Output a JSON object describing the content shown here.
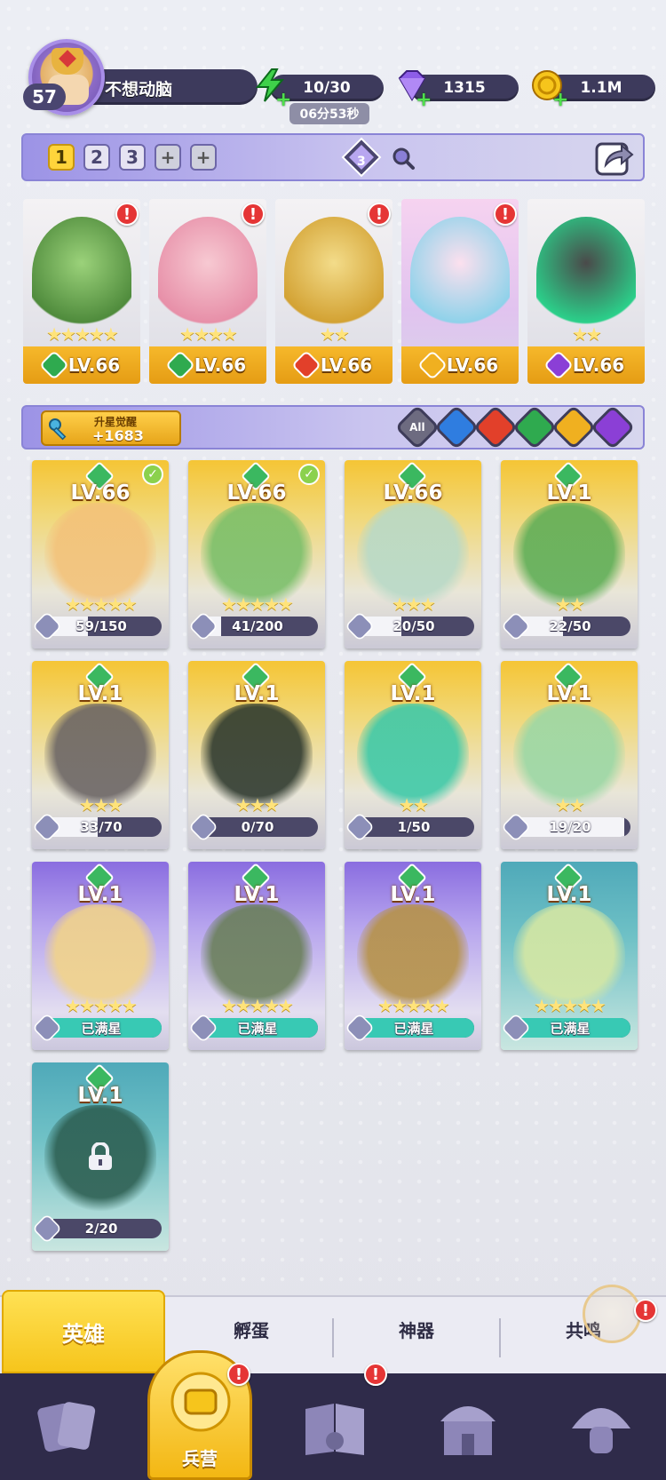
{
  "player": {
    "level": "57",
    "name": "不想动脑"
  },
  "resources": {
    "energy": {
      "value": "10/30",
      "timer": "06分53秒",
      "icon": "lightning-icon"
    },
    "gems": {
      "value": "1315",
      "icon": "gem-icon"
    },
    "gold": {
      "value": "1.1M",
      "icon": "coin-icon"
    }
  },
  "team_bar": {
    "tabs": [
      "1",
      "2",
      "3",
      "+",
      "+"
    ],
    "active_tab": "1",
    "crystal_count": "3"
  },
  "team": [
    {
      "level": "LV.66",
      "stars": 5,
      "element": "nature",
      "alert": "!"
    },
    {
      "level": "LV.66",
      "stars": 4,
      "element": "nature",
      "alert": "!"
    },
    {
      "level": "LV.66",
      "stars": 2,
      "element": "fire",
      "alert": "!"
    },
    {
      "level": "LV.66",
      "stars": 0,
      "element": "light",
      "alert": "!"
    },
    {
      "level": "LV.66",
      "stars": 2,
      "element": "dark",
      "alert": ""
    }
  ],
  "awaken": {
    "label": "升星觉醒",
    "count": "+1683"
  },
  "filters": [
    {
      "label": "All",
      "color": "#6d6b80",
      "icon": "all-filter-icon"
    },
    {
      "label": "",
      "color": "#2f7de0",
      "icon": "water-filter-icon"
    },
    {
      "label": "",
      "color": "#e2402a",
      "icon": "fire-filter-icon"
    },
    {
      "label": "",
      "color": "#2faa4f",
      "icon": "nature-filter-icon"
    },
    {
      "label": "",
      "color": "#f0b020",
      "icon": "light-filter-icon"
    },
    {
      "label": "",
      "color": "#8b3fd6",
      "icon": "dark-filter-icon"
    }
  ],
  "heroes": [
    {
      "level": "LV.66",
      "progress": "59/150",
      "frac": 0.39,
      "stars": 5,
      "rarity": "gold",
      "checked": true,
      "art": "#f3c27a"
    },
    {
      "level": "LV.66",
      "progress": "41/200",
      "frac": 0.2,
      "stars": 5,
      "rarity": "gold",
      "checked": true,
      "art": "#7bbf6a"
    },
    {
      "level": "LV.66",
      "progress": "20/50",
      "frac": 0.4,
      "stars": 3,
      "rarity": "gold",
      "checked": false,
      "art": "#b8d9c7"
    },
    {
      "level": "LV.1",
      "progress": "22/50",
      "frac": 0.44,
      "stars": 2,
      "rarity": "gold",
      "checked": false,
      "art": "#5fae57"
    },
    {
      "level": "LV.1",
      "progress": "33/70",
      "frac": 0.47,
      "stars": 3,
      "rarity": "gold",
      "checked": false,
      "art": "#6b6565"
    },
    {
      "level": "LV.1",
      "progress": "0/70",
      "frac": 0.0,
      "stars": 3,
      "rarity": "gold",
      "checked": false,
      "art": "#2f3a2f"
    },
    {
      "level": "LV.1",
      "progress": "1/50",
      "frac": 0.02,
      "stars": 2,
      "rarity": "gold",
      "checked": false,
      "art": "#3fc9a8"
    },
    {
      "level": "LV.1",
      "progress": "19/20",
      "frac": 0.95,
      "stars": 2,
      "rarity": "gold",
      "checked": false,
      "art": "#9bd7a5"
    },
    {
      "level": "LV.1",
      "progress": "已满星",
      "frac": 1.0,
      "stars": 5,
      "rarity": "purple",
      "checked": false,
      "art": "#f1d38a"
    },
    {
      "level": "LV.1",
      "progress": "已满星",
      "frac": 1.0,
      "stars": 5,
      "rarity": "purple",
      "checked": false,
      "art": "#6a7f5a"
    },
    {
      "level": "LV.1",
      "progress": "已满星",
      "frac": 1.0,
      "stars": 5,
      "rarity": "purple",
      "checked": false,
      "art": "#b69248"
    },
    {
      "level": "LV.1",
      "progress": "已满星",
      "frac": 1.0,
      "stars": 5,
      "rarity": "teal",
      "checked": false,
      "art": "#d5e7a3"
    },
    {
      "level": "LV.1",
      "progress": "2/20",
      "frac": 0.1,
      "stars": 0,
      "rarity": "teal",
      "checked": false,
      "art": "#2d5f52",
      "locked": true
    }
  ],
  "section_tabs": [
    "英雄",
    "孵蛋",
    "神器",
    "共鸣"
  ],
  "bottom_nav": {
    "items": [
      "cards-icon",
      "barracks-icon",
      "book-icon",
      "temple-icon",
      "mushroom-icon"
    ],
    "active_label": "兵营"
  },
  "colors": {
    "accent_gold": "#f6c51c",
    "panel": "#3d3a5c",
    "alert": "#e53535"
  }
}
